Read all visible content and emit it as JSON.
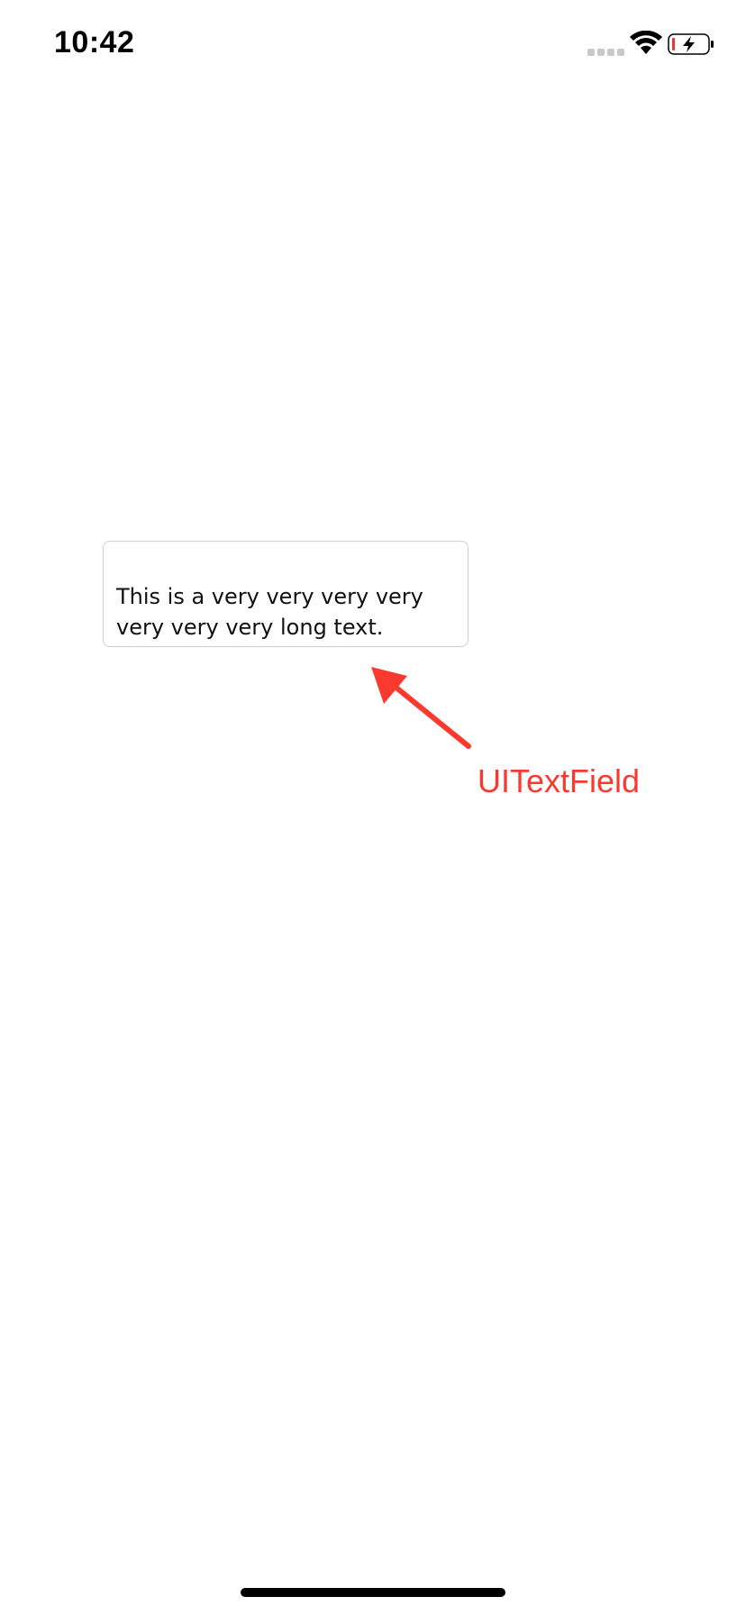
{
  "status_bar": {
    "time": "10:42",
    "icons": [
      "cellular-signal-icon",
      "wifi-icon",
      "battery-charging-icon"
    ],
    "battery_color": "#e53935"
  },
  "text_field": {
    "value": "This is a very very very very very very very long text."
  },
  "annotation": {
    "label": "UITextField",
    "color": "#fb3a2f",
    "icon": "arrow-icon"
  }
}
